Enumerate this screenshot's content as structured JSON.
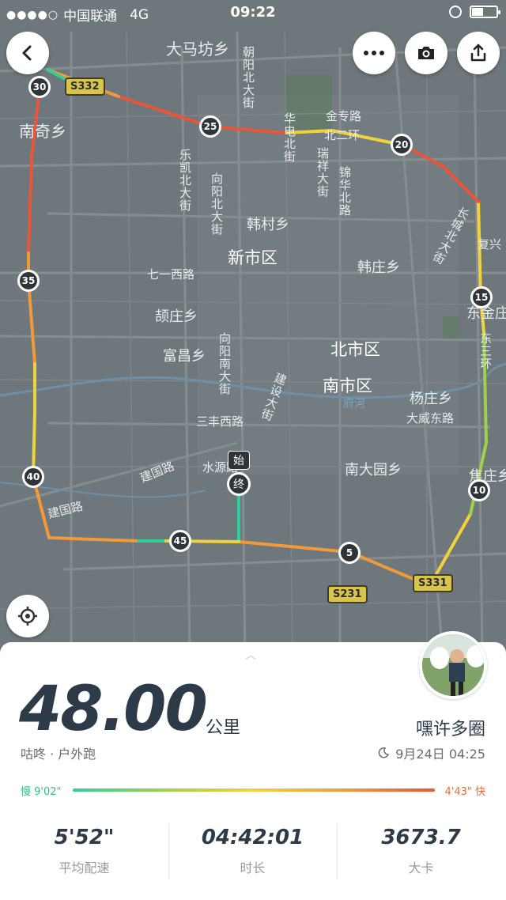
{
  "status_bar": {
    "carrier": "中国联通",
    "network": "4G",
    "time": "09:22"
  },
  "map": {
    "labels": {
      "damafang": "大马坊乡",
      "nanqi": "南奇乡",
      "xinshi": "新市区",
      "hancun": "韩村乡",
      "hanzhuang": "韩庄乡",
      "qiyi": "七一西路",
      "yingzhuang": "颉庄乡",
      "fuchang": "富昌乡",
      "beishi": "北市区",
      "nanshi": "南市区",
      "yangzhuang": "杨庄乡",
      "sanfeng": "三丰西路",
      "dawei": "大威东路",
      "shuiyuan": "水源路",
      "jianguo1": "建国路",
      "jianguo2": "建国路",
      "nandayuan": "南大园乡",
      "jinzhuan": "金专路",
      "beier": "北二环",
      "jiaozhuang": "焦庄乡",
      "dongjin": "东金庄",
      "fuhe": "府河",
      "xinghua": "复兴",
      "chaoyang": "朝阳北大街",
      "lekai_n": "乐凯北大街",
      "xiangyang_n": "向阳北大街",
      "xiangyang_s": "向阳南大街",
      "ruixiang": "瑞祥大街",
      "changcheng": "长城北大街",
      "jianshe": "建设大街",
      "jiaoyu": "东三环",
      "huayuan": "华电北街",
      "xianhua": "锦华北路"
    },
    "road_signs": {
      "s332": "S332",
      "s231": "S231",
      "s331": "S331"
    },
    "km_markers": {
      "m30": "30",
      "m25": "25",
      "m20": "20",
      "m35": "35",
      "m15": "15",
      "m40": "40",
      "m10": "10",
      "m45": "45",
      "m5": "5"
    },
    "start_label": "始",
    "end_label": "终",
    "route_colors": {
      "slow": "#2fcf9a",
      "mid": "#f2d23a",
      "fast": "#e9553a"
    }
  },
  "card": {
    "distance": "48.00",
    "unit": "公里",
    "username": "嘿许多圈",
    "source": "咕咚 · 户外跑",
    "date": "9月24日 04:25",
    "pace_slow": "慢 9'02\"",
    "pace_fast": "4'43\" 快",
    "stats": [
      {
        "value": "5'52\"",
        "label": "平均配速"
      },
      {
        "value": "04:42:01",
        "label": "时长"
      },
      {
        "value": "3673.7",
        "label": "大卡"
      }
    ]
  },
  "icons": {
    "back": "chevron-left-icon",
    "more": "more-dots-icon",
    "camera": "camera-icon",
    "share": "share-icon",
    "locate": "locate-icon",
    "moon": "moon-icon",
    "collapse": "chevron-up-icon"
  }
}
